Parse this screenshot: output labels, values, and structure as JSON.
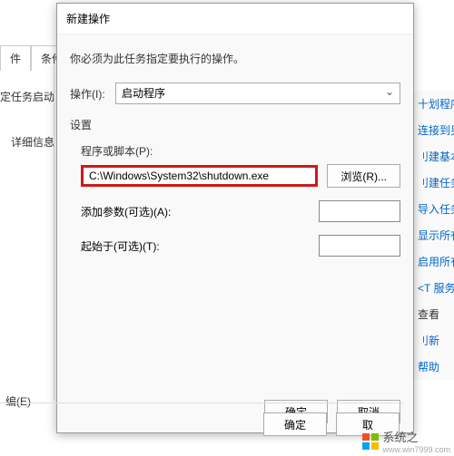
{
  "background": {
    "tab_file": "件",
    "tab_condition": "条件",
    "tab_detail": "详细信息",
    "set_task": "定任务启动",
    "edit": "编(E)"
  },
  "right": {
    "items": [
      "十划程序",
      "连接到另",
      "刂建基本",
      "刂建任务",
      "导入任务",
      "显示所有",
      "启用所有",
      "<T 服务",
      "查看",
      "刂新",
      "帮助"
    ]
  },
  "dialog": {
    "title": "新建操作",
    "instruction": "你必须为此任务指定要执行的操作。",
    "action_label": "操作(I):",
    "action_value": "启动程序",
    "settings_label": "设置",
    "program_label": "程序或脚本(P):",
    "program_value": "C:\\Windows\\System32\\shutdown.exe",
    "browse_label": "浏览(R)...",
    "args_label": "添加参数(可选)(A):",
    "args_value": "",
    "startin_label": "起始于(可选)(T):",
    "startin_value": "",
    "ok_label": "确定",
    "cancel_label": "取消"
  },
  "outer_footer": {
    "ok": "确定",
    "cancel": "取"
  },
  "watermark": {
    "text": "系统之",
    "url": "www.win7999.com"
  }
}
